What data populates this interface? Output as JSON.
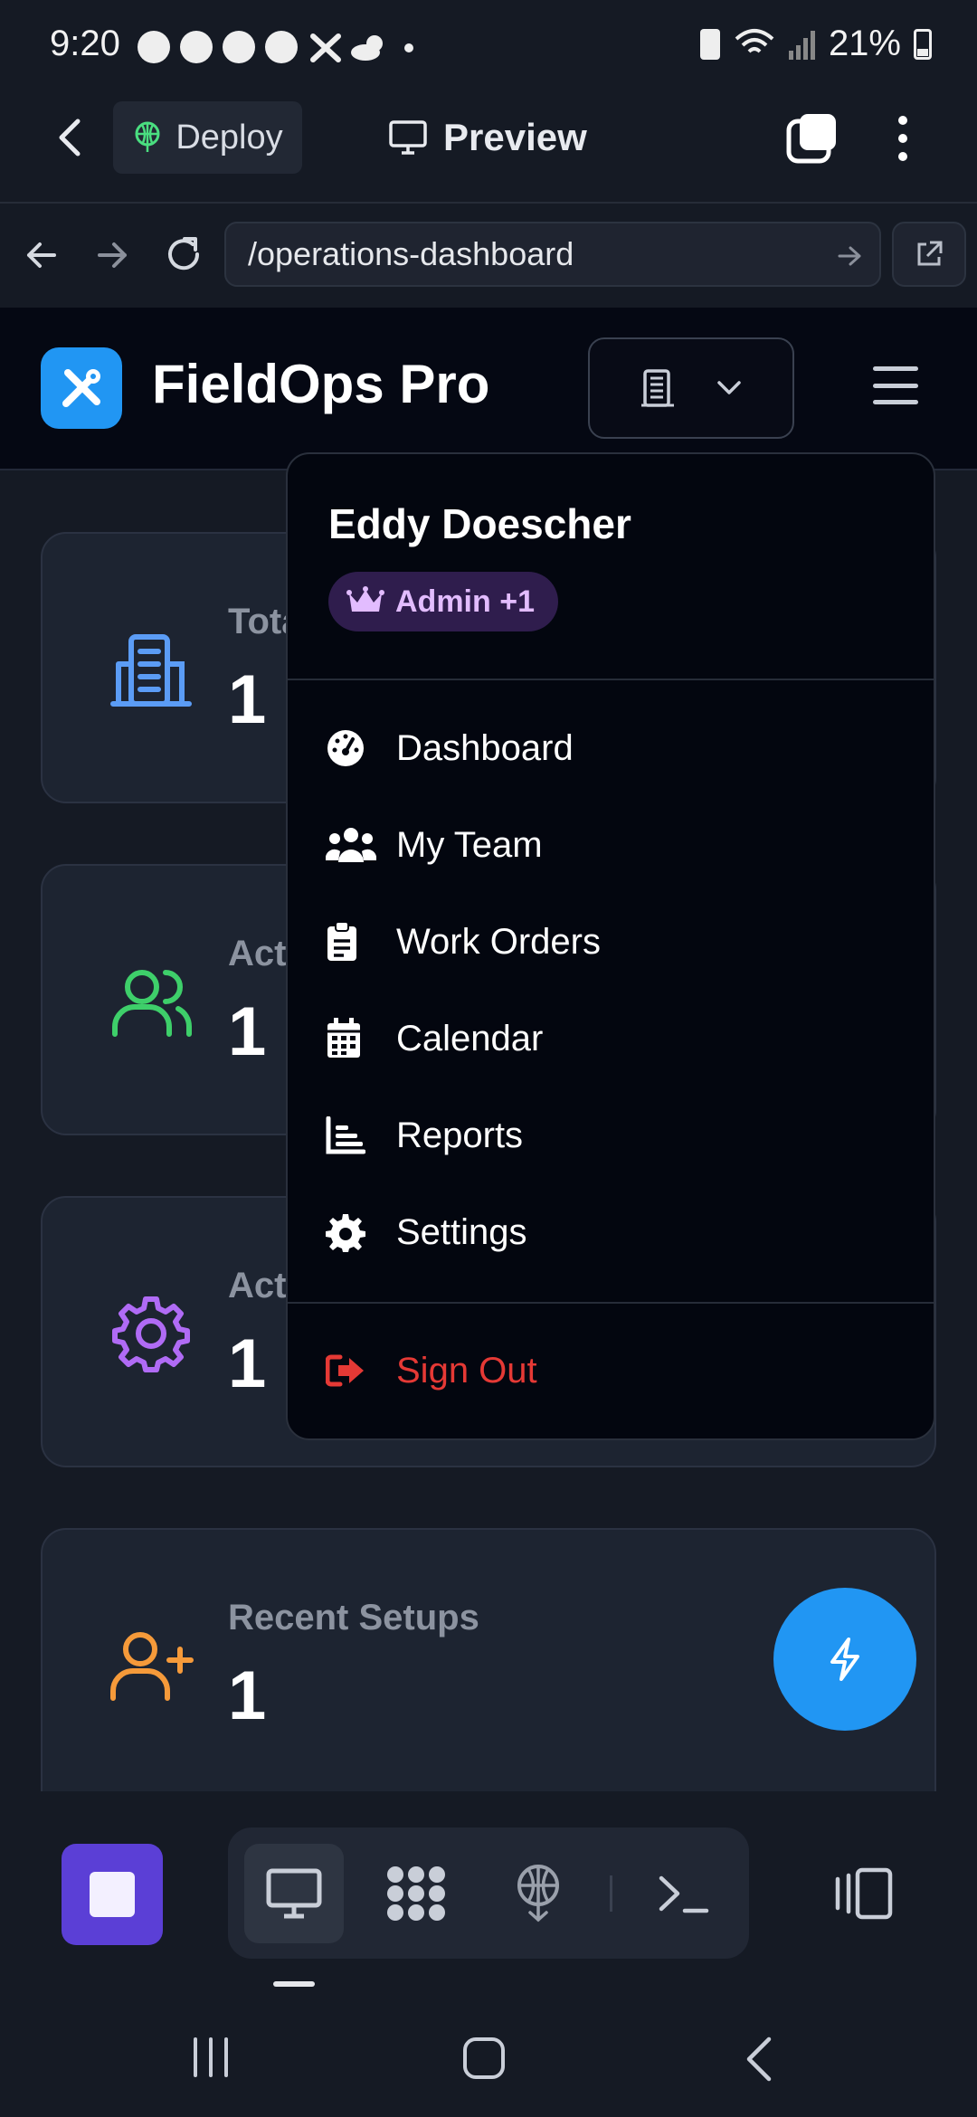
{
  "status_bar": {
    "time": "9:20",
    "battery": "21%"
  },
  "toolbar": {
    "deploy_label": "Deploy",
    "preview_label": "Preview"
  },
  "browser": {
    "url": "/operations-dashboard"
  },
  "app": {
    "brand": "FieldOps Pro"
  },
  "cards": [
    {
      "label": "Tota",
      "value": "1",
      "icon": "building-icon",
      "color": "#5b9cf5"
    },
    {
      "label": "Act",
      "value": "1",
      "icon": "users-icon",
      "color": "#3ecf6a"
    },
    {
      "label": "Act",
      "value": "1",
      "icon": "gear-icon",
      "color": "#b06bf5"
    },
    {
      "label": "Recent Setups",
      "value": "1",
      "icon": "user-plus-icon",
      "color": "#f59a3a"
    }
  ],
  "menu": {
    "user_name": "Eddy Doescher",
    "role_badge": "Admin +1",
    "items": [
      {
        "label": "Dashboard",
        "icon": "dashboard-gauge-icon"
      },
      {
        "label": "My Team",
        "icon": "team-icon"
      },
      {
        "label": "Work Orders",
        "icon": "clipboard-icon"
      },
      {
        "label": "Calendar",
        "icon": "calendar-icon"
      },
      {
        "label": "Reports",
        "icon": "chart-icon"
      },
      {
        "label": "Settings",
        "icon": "settings-icon"
      }
    ],
    "sign_out": "Sign Out"
  },
  "colors": {
    "accent": "#2196f3",
    "danger": "#e53935",
    "badge_bg": "#2f1d4d",
    "badge_text": "#e2bcff"
  }
}
